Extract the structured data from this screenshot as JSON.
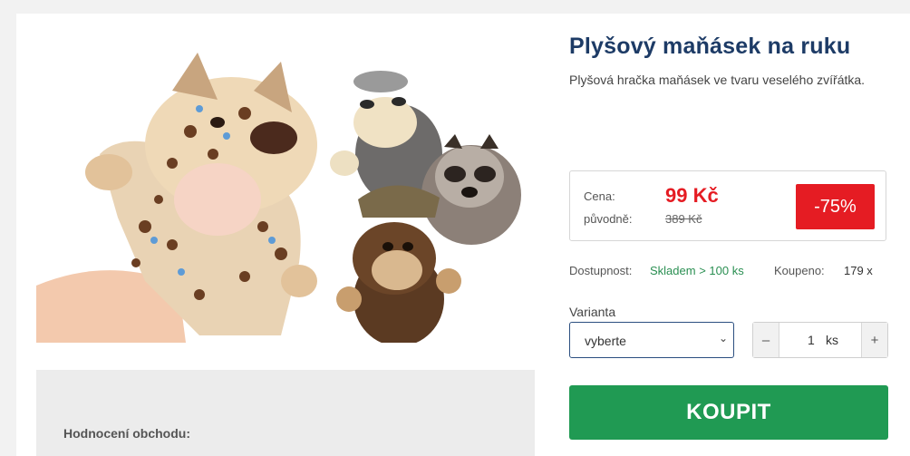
{
  "product": {
    "title": "Plyšový maňásek na ruku",
    "subtitle": "Plyšová hračka maňásek ve tvaru veselého zvířátka.",
    "image_alt": "Plyšoví maňásci zvířátek"
  },
  "price": {
    "current_label": "Cena:",
    "current_value": "99 Kč",
    "original_label": "původně:",
    "original_value": "389 Kč",
    "discount": "-75%"
  },
  "availability": {
    "label": "Dostupnost:",
    "value": "Skladem > 100 ks",
    "sold_label": "Koupeno:",
    "sold_value": "179 x"
  },
  "variant": {
    "label": "Varianta",
    "selected": "vyberte"
  },
  "quantity": {
    "minus": "–",
    "value": "1",
    "unit": "ks",
    "plus": "+"
  },
  "buy_button": "KOUPIT",
  "rating": {
    "label": "Hodnocení obchodu:"
  },
  "colors": {
    "title": "#1d3b66",
    "price": "#e51c23",
    "badge": "#e51c23",
    "stock": "#2a8f52",
    "buy": "#209a53"
  }
}
